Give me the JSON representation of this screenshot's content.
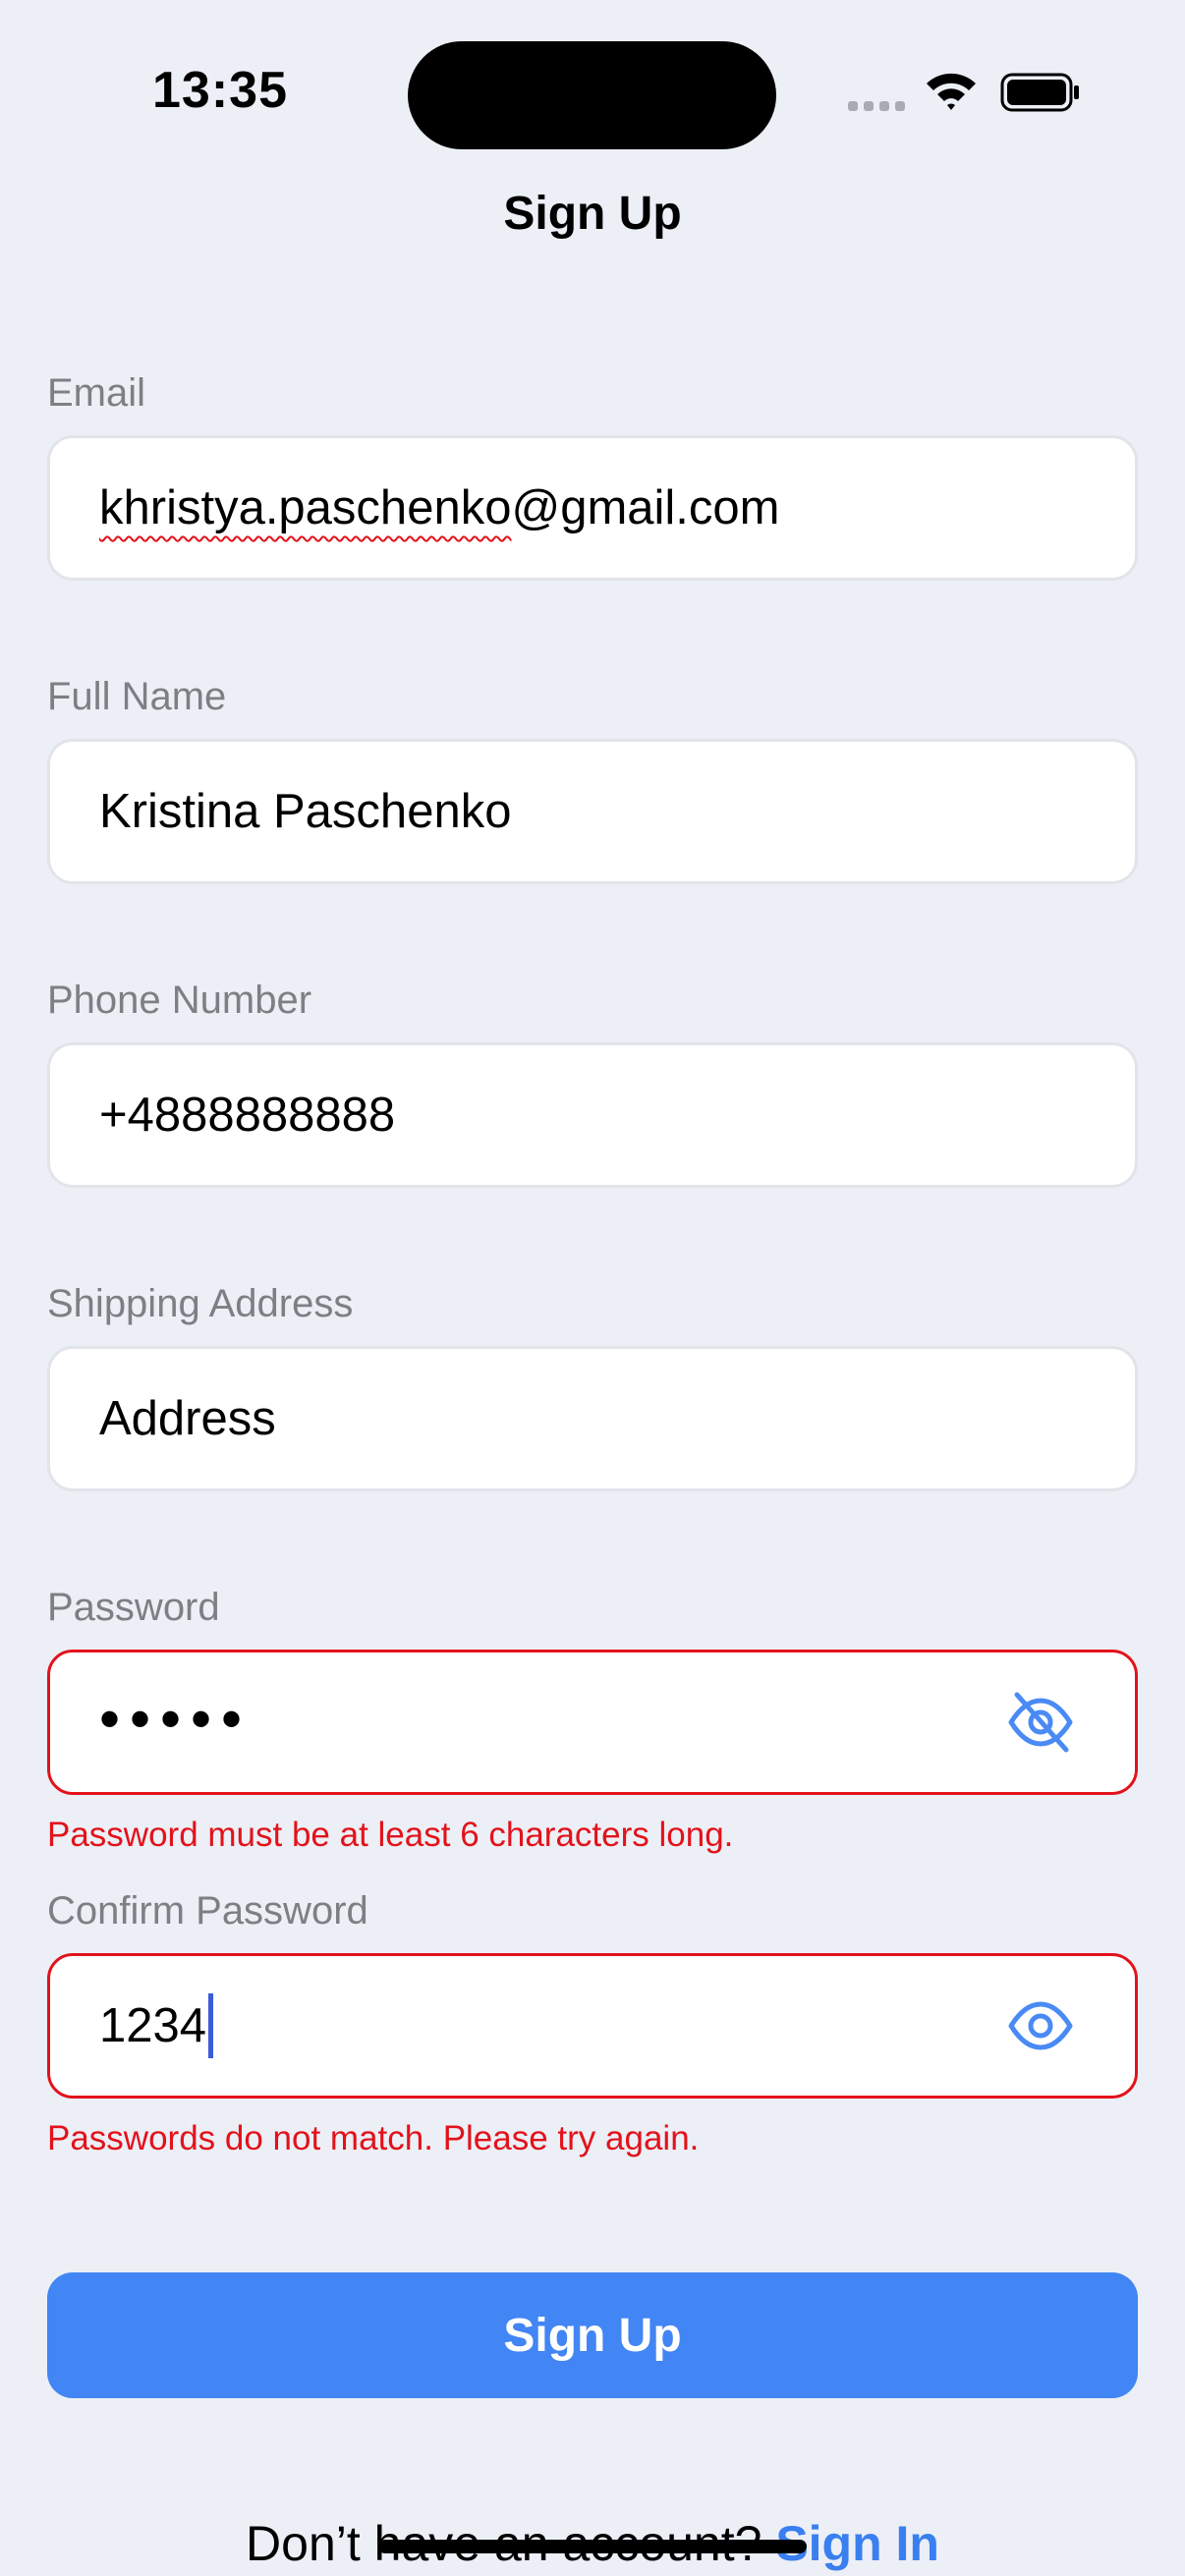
{
  "status_bar": {
    "time": "13:35",
    "icons": [
      "signal-icon",
      "wifi-icon",
      "battery-icon"
    ]
  },
  "header": {
    "title": "Sign Up"
  },
  "form": {
    "email": {
      "label": "Email",
      "value": "khristya.paschenko@gmail.com",
      "spellcheck_flagged": "khristya.paschenko"
    },
    "full_name": {
      "label": "Full Name",
      "value": "Kristina Paschenko"
    },
    "phone": {
      "label": "Phone Number",
      "value": "+4888888888"
    },
    "address": {
      "label": "Shipping Address",
      "placeholder": "Address"
    },
    "password": {
      "label": "Password",
      "masked_value": "•••••",
      "toggle_icon": "eye-off-icon",
      "error": "Password must be at least 6 characters long."
    },
    "confirm_password": {
      "label": "Confirm Password",
      "value": "1234",
      "toggle_icon": "eye-icon",
      "error": "Passwords do not match. Please try again."
    }
  },
  "actions": {
    "submit_label": "Sign Up"
  },
  "footer": {
    "prompt": "Don’t have an account?",
    "link_label": "Sign In"
  },
  "colors": {
    "background": "#eceff6",
    "primary": "#4285f4",
    "link": "#3a7ff0",
    "error": "#e3121b",
    "label": "#7d7f84"
  }
}
